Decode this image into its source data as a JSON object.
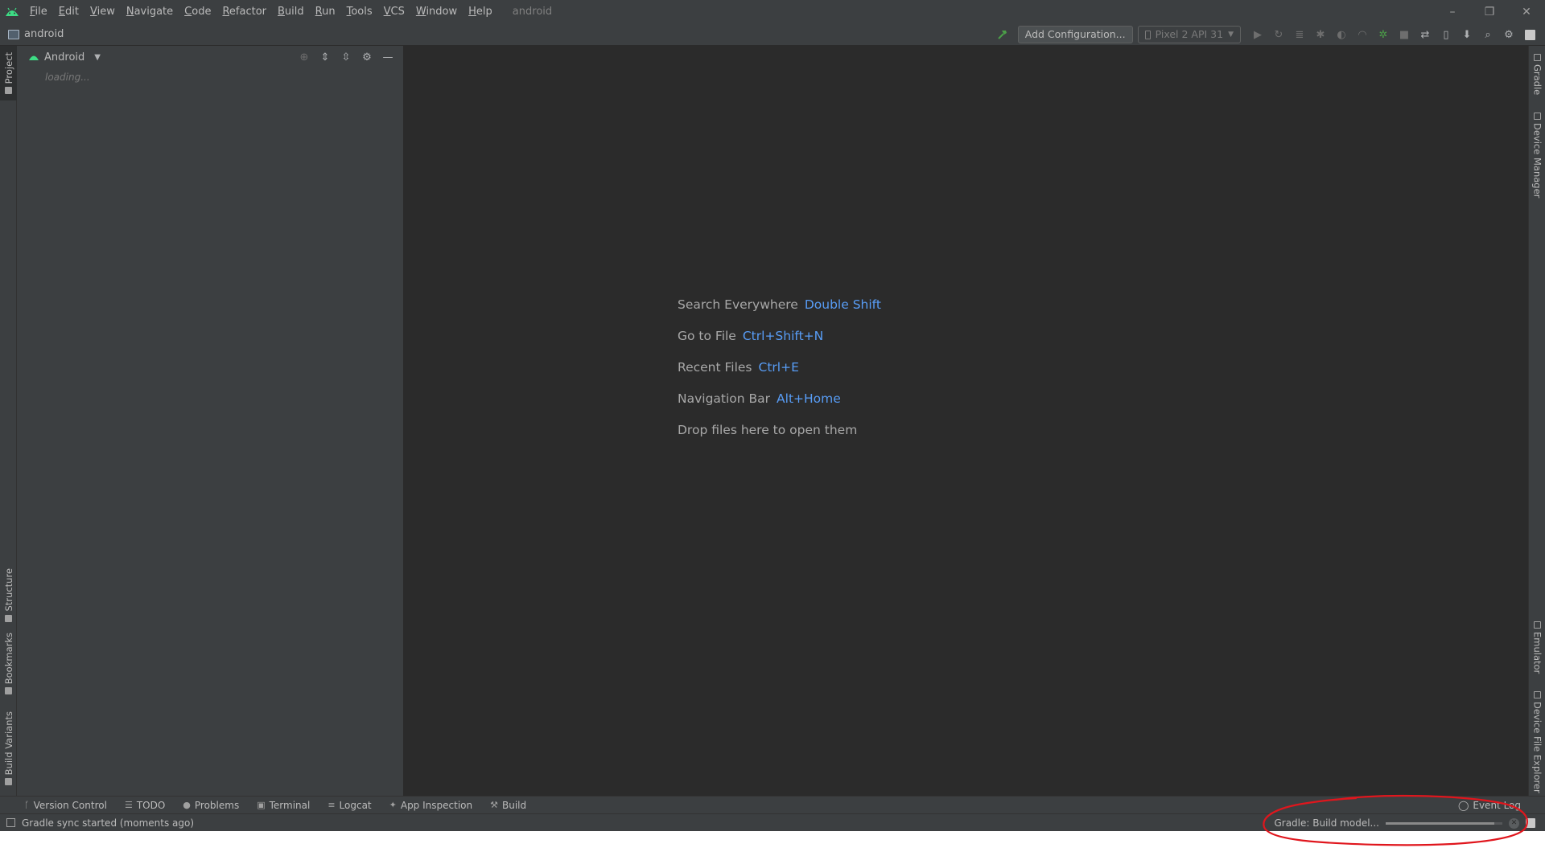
{
  "menubar": {
    "items": [
      "File",
      "Edit",
      "View",
      "Navigate",
      "Code",
      "Refactor",
      "Build",
      "Run",
      "Tools",
      "VCS",
      "Window",
      "Help"
    ],
    "title": "android",
    "window_controls": [
      "–",
      "❐",
      "✕"
    ]
  },
  "navbar": {
    "project_name": "android",
    "add_configuration": "Add Configuration...",
    "device": "Pixel 2 API 31"
  },
  "left_stripe": {
    "project": "Project",
    "structure": "Structure",
    "bookmarks": "Bookmarks",
    "build_variants": "Build Variants"
  },
  "right_stripe": {
    "gradle": "Gradle",
    "device_manager": "Device Manager",
    "emulator": "Emulator",
    "device_file_explorer": "Device File Explorer"
  },
  "project_panel": {
    "view": "Android",
    "loading": "loading..."
  },
  "editor": {
    "hints": [
      {
        "label": "Search Everywhere",
        "key": "Double Shift"
      },
      {
        "label": "Go to File",
        "key": "Ctrl+Shift+N"
      },
      {
        "label": "Recent Files",
        "key": "Ctrl+E"
      },
      {
        "label": "Navigation Bar",
        "key": "Alt+Home"
      },
      {
        "label": "Drop files here to open them",
        "key": ""
      }
    ]
  },
  "bottom_tabs": {
    "items": [
      "Version Control",
      "TODO",
      "Problems",
      "Terminal",
      "Logcat",
      "App Inspection",
      "Build"
    ],
    "event_log": "Event Log"
  },
  "status": {
    "message": "Gradle sync started (moments ago)",
    "progress_label": "Gradle: Build model...",
    "progress_fraction": 0.93
  },
  "colors": {
    "accent_green": "#3ddc84",
    "shortcut_blue": "#589df6",
    "annotation_red": "#e0161d"
  }
}
